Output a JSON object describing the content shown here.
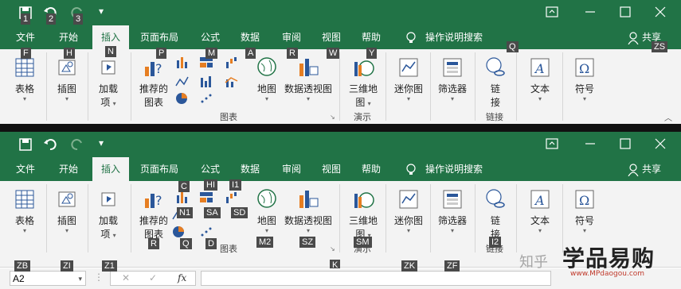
{
  "window": {
    "title_icons": [
      "save-icon",
      "undo-icon",
      "redo-icon",
      "customize-icon"
    ],
    "controls": [
      "ribbon-display-icon",
      "minimize-icon",
      "maximize-icon",
      "close-icon"
    ]
  },
  "tabs": {
    "file": "文件",
    "home": "开始",
    "insert": "插入",
    "page_layout": "页面布局",
    "formulas": "公式",
    "data": "数据",
    "review": "审阅",
    "view": "视图",
    "help": "帮助",
    "tell_me": "操作说明搜索",
    "share": "共享"
  },
  "ribbon": {
    "tables": "表格",
    "illustrations": "插图",
    "addins_line1": "加载",
    "addins_line2": "项",
    "recommended_line1": "推荐的",
    "recommended_line2": "图表",
    "maps": "地图",
    "pivotchart": "数据透视图",
    "map3d_line1": "三维地",
    "map3d_line2": "图",
    "sparklines": "迷你图",
    "filters": "筛选器",
    "link_line1": "链",
    "link_line2": "接",
    "text": "文本",
    "symbols": "符号",
    "group_charts": "图表",
    "group_tours": "演示",
    "group_links": "链接"
  },
  "keytips_top": {
    "save": "1",
    "undo": "2",
    "redo": "3",
    "file": "F",
    "home": "H",
    "insert": "N",
    "page_layout": "P",
    "formulas": "M",
    "data": "A",
    "review": "R",
    "view": "W",
    "help": "Y",
    "tell_me": "Q",
    "share": "ZS"
  },
  "keytips_bottom": {
    "c": "C",
    "hi": "HI",
    "i1": "I1",
    "n1": "N1",
    "sa": "SA",
    "sd": "SD",
    "r": "R",
    "q": "Q",
    "d": "D",
    "m2": "M2",
    "sz": "SZ",
    "sm": "SM",
    "i2": "I2",
    "k": "K",
    "zb": "ZB",
    "zi": "ZI",
    "z1": "Z1",
    "zk": "ZK",
    "zf": "ZF"
  },
  "formula_bar": {
    "namebox": "A2",
    "cancel": "✕",
    "enter": "✓",
    "fx": "fx"
  },
  "watermark": {
    "zhihu": "知乎",
    "brand": "学品易购",
    "url": "www.MPdaogou.com"
  },
  "colors": {
    "excel_green": "#217346",
    "ribbon_bg": "#f3f3f3",
    "keytip_bg": "#4a4a4a"
  }
}
